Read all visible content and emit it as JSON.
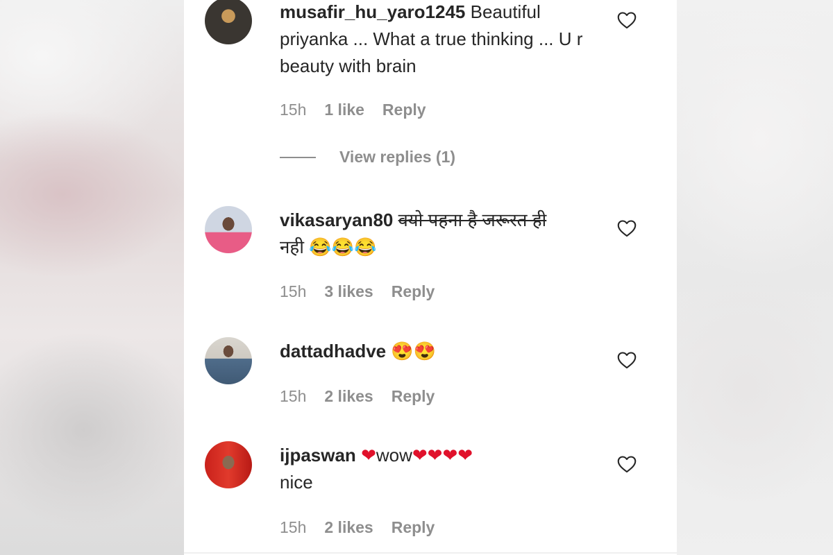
{
  "comments": [
    {
      "username": "musafir_hu_yaro1245",
      "text": "Beautiful priyanka ... What a true thinking ... U r beauty with brain",
      "time": "15h",
      "likes": "1 like",
      "reply": "Reply"
    },
    {
      "username": "vikasaryan80",
      "text_struck": "क्यो पहना है जरूरत ही",
      "text_rest": "नही",
      "emojis": "😂😂😂",
      "time": "15h",
      "likes": "3 likes",
      "reply": "Reply"
    },
    {
      "username": "dattadhadve",
      "emojis": "😍😍",
      "time": "15h",
      "likes": "2 likes",
      "reply": "Reply"
    },
    {
      "username": "ijpaswan",
      "emoji_heart": "❤",
      "text": "wow",
      "emojis_hearts": "❤❤❤❤",
      "text2": "nice",
      "time": "15h",
      "likes": "2 likes",
      "reply": "Reply"
    }
  ],
  "view_replies": "View replies (1)",
  "icons": {
    "like": "heart-outline-icon"
  },
  "colors": {
    "text": "#262626",
    "secondary": "#8e8e8e",
    "panel": "#ffffff"
  }
}
